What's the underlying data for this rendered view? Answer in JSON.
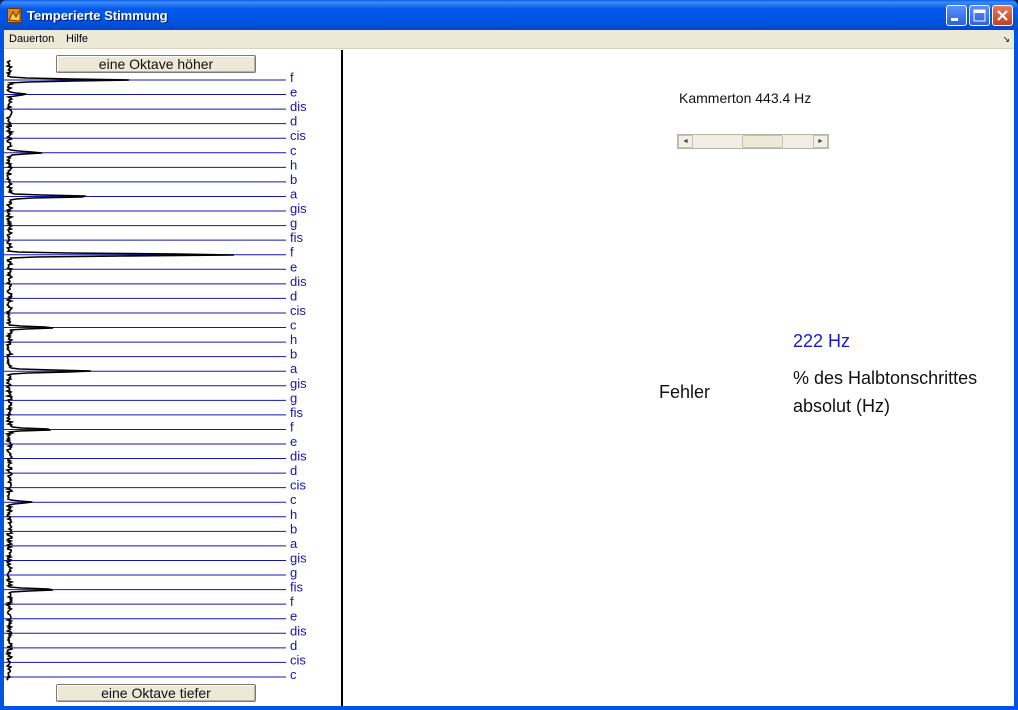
{
  "window": {
    "title": "Temperierte Stimmung",
    "icon": "matlab-icon"
  },
  "titlebar_buttons": [
    "minimize-icon",
    "maximize-icon",
    "close-icon"
  ],
  "menubar": {
    "items": [
      "Dauerton",
      "Hilfe"
    ],
    "dock_icon": "dock-arrow-icon",
    "dock_glyph": "↘"
  },
  "left_panel": {
    "octave_up_label": "eine Oktave höher",
    "octave_down_label": "eine Oktave tiefer",
    "note_labels": [
      "f",
      "e",
      "dis",
      "d",
      "cis",
      "c",
      "h",
      "b",
      "a",
      "gis",
      "g",
      "fis",
      "f",
      "e",
      "dis",
      "d",
      "cis",
      "c",
      "h",
      "b",
      "a",
      "gis",
      "g",
      "fis",
      "f",
      "e",
      "dis",
      "d",
      "cis",
      "c",
      "h",
      "b",
      "a",
      "gis",
      "g",
      "fis",
      "f",
      "e",
      "dis",
      "d",
      "cis",
      "c"
    ],
    "note_line_color": "#1414b4",
    "spectrum_color": "#000000",
    "spectrum_peaks": [
      {
        "note_index": 0,
        "strength": 0.43
      },
      {
        "note_index": 1,
        "strength": 0.07
      },
      {
        "note_index": 5,
        "strength": 0.14
      },
      {
        "note_index": 8,
        "strength": 0.3
      },
      {
        "note_index": 12,
        "strength": 0.94
      },
      {
        "note_index": 17,
        "strength": 0.17
      },
      {
        "note_index": 20,
        "strength": 0.33
      },
      {
        "note_index": 24,
        "strength": 0.17
      },
      {
        "note_index": 29,
        "strength": 0.1
      },
      {
        "note_index": 35,
        "strength": 0.19
      }
    ]
  },
  "controls": {
    "kammerton_label": "Kammerton 443.4 Hz",
    "kammerton_slider_fraction": 0.62
  },
  "readout": {
    "frequency": "222 Hz",
    "frequency_color": "#1a1ac8",
    "fehler_label": "Fehler",
    "percent_label": "% des Halbtonschrittes",
    "absolut_label": "absolut (Hz)"
  }
}
